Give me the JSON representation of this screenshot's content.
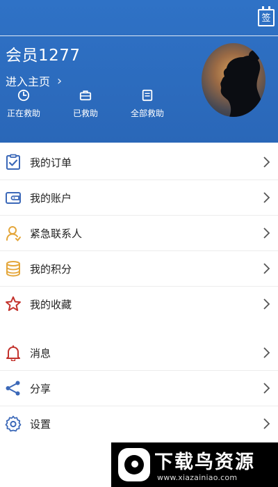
{
  "header": {
    "member_name": "会员1277",
    "enter_home_label": "进入主页",
    "signin_label": "签",
    "stats": [
      {
        "label": "正在救助",
        "icon": "clock-icon"
      },
      {
        "label": "已救助",
        "icon": "briefcase-icon"
      },
      {
        "label": "全部救助",
        "icon": "document-icon"
      }
    ]
  },
  "menu": {
    "items": [
      {
        "label": "我的订单",
        "icon": "clipboard-check-icon",
        "color": "#3b68b8"
      },
      {
        "label": "我的账户",
        "icon": "wallet-icon",
        "color": "#3b68b8"
      },
      {
        "label": "紧急联系人",
        "icon": "person-icon",
        "color": "#e4a63a"
      },
      {
        "label": "我的积分",
        "icon": "coin-stack-icon",
        "color": "#e4a63a"
      },
      {
        "label": "我的收藏",
        "icon": "star-icon",
        "color": "#c3322c"
      },
      {
        "label": "消息",
        "icon": "bell-icon",
        "color": "#c3322c"
      },
      {
        "label": "分享",
        "icon": "share-icon",
        "color": "#3b68b8"
      },
      {
        "label": "设置",
        "icon": "gear-icon",
        "color": "#3b68b8"
      }
    ]
  },
  "watermark": {
    "title": "下载鸟资源",
    "url": "www.xiazainiao.com"
  },
  "colors": {
    "header_bg": "#2e6fc3",
    "accent_blue": "#3b68b8",
    "accent_orange": "#e4a63a",
    "accent_red": "#c3322c"
  }
}
